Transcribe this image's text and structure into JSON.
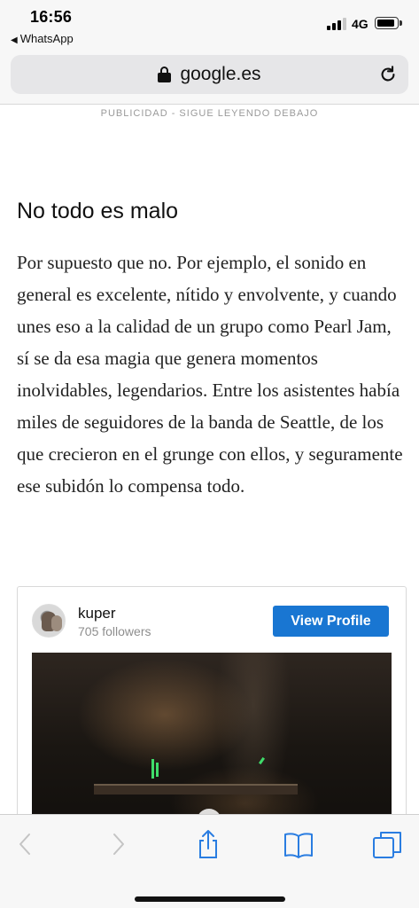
{
  "status_bar": {
    "time": "16:56",
    "back_app": "WhatsApp",
    "network": "4G",
    "signal_bars_filled": 3,
    "signal_bars_total": 4
  },
  "url_bar": {
    "domain": "google.es",
    "secure": true
  },
  "ad_label": "PUBLICIDAD - SIGUE LEYENDO DEBAJO",
  "article": {
    "heading": "No todo es malo",
    "paragraph": "Por supuesto que no. Por ejemplo, el sonido en general es excelente, nítido y envolvente, y cuando unes eso a la calidad de un grupo como Pearl Jam, sí se da esa magia que genera momentos inolvidables, legendarios. Entre los asistentes había miles de seguidores de la banda de Seattle, de los que crecieron en el grunge con ellos, y seguramente ese subidón lo compensa todo."
  },
  "embed": {
    "username": "kuper",
    "followers": "705 followers",
    "view_profile_label": "View Profile"
  },
  "toolbar": {
    "icons": [
      "back-icon",
      "forward-icon",
      "share-icon",
      "bookmarks-icon",
      "tabs-icon"
    ]
  },
  "colors": {
    "accent": "#1976d2",
    "toolbar_active": "#2a7de1",
    "toolbar_disabled": "#c4c4c4"
  }
}
